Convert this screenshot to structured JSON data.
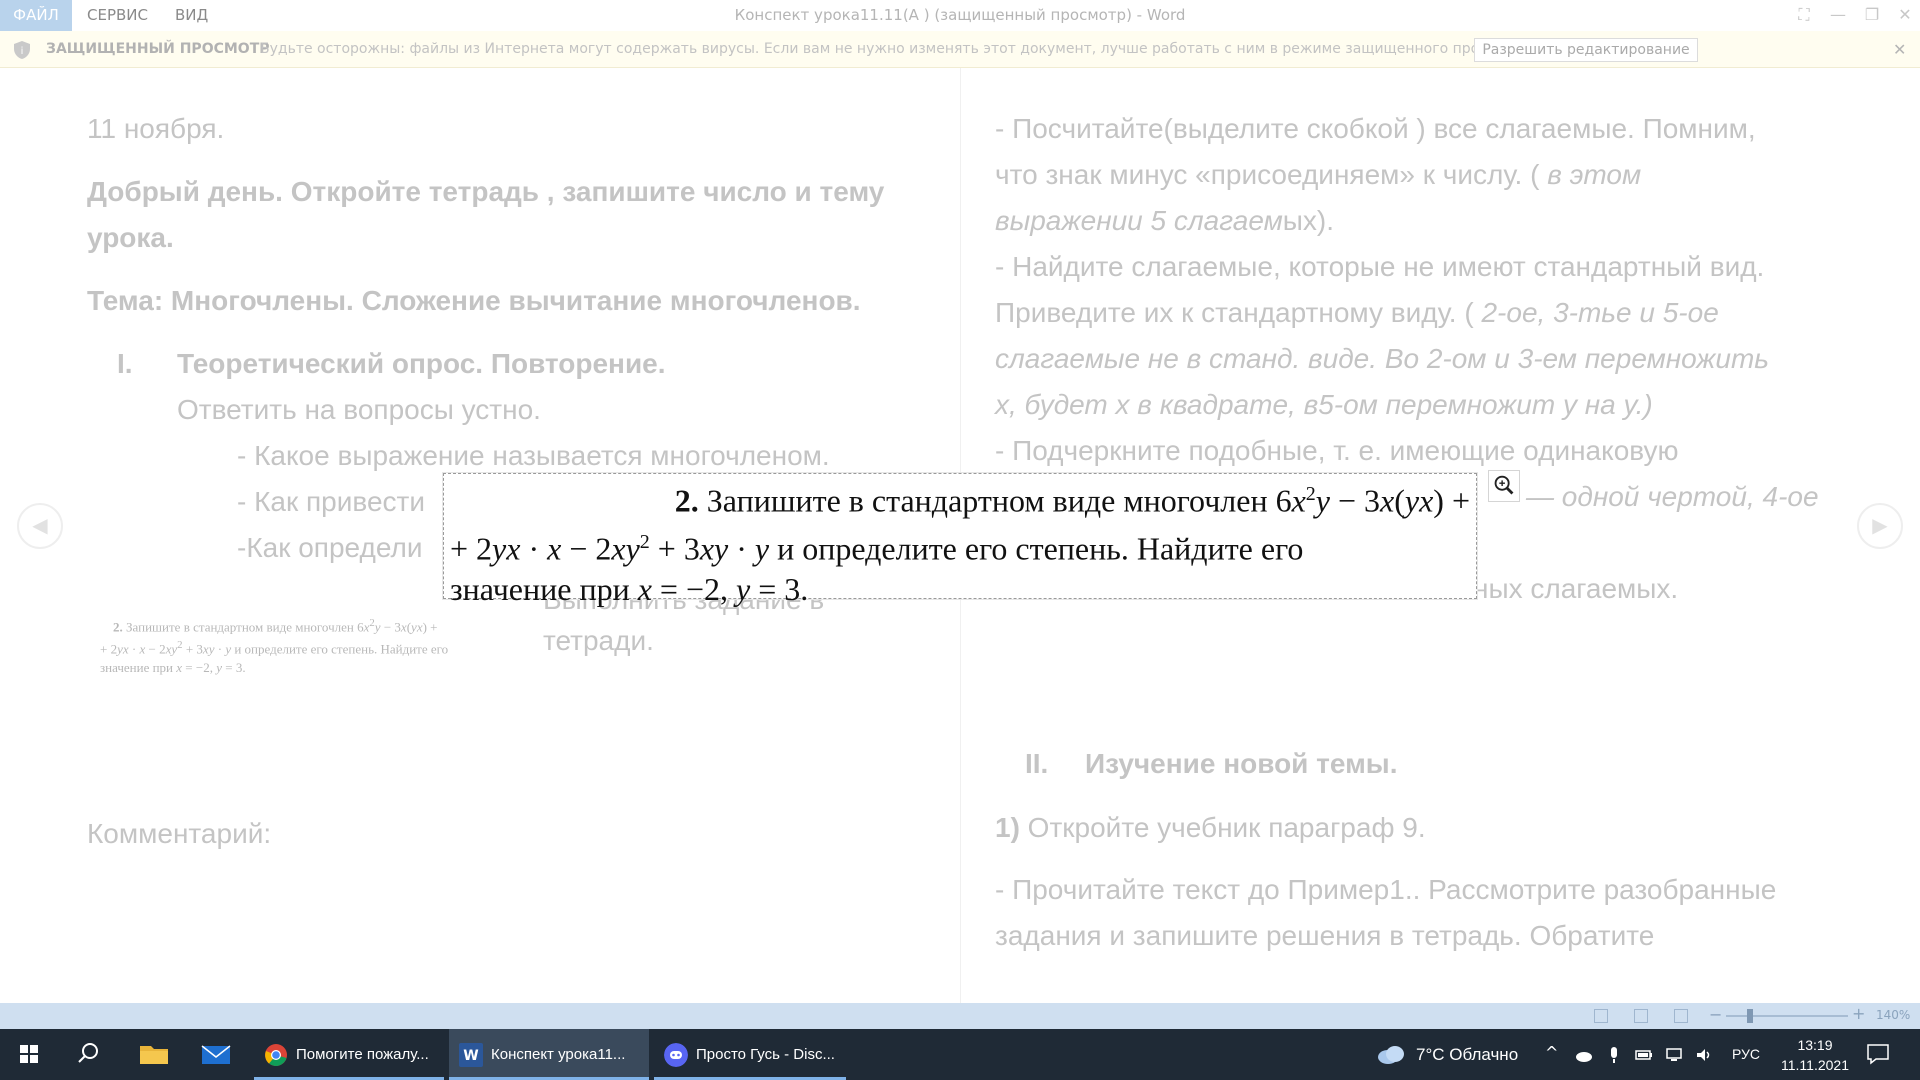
{
  "titlebar": {
    "tabs": [
      "ФАЙЛ",
      "СЕРВИС",
      "ВИД"
    ],
    "title": "Конспект урока11.11(А ) (защищенный просмотр) - Word"
  },
  "protected_view": {
    "label": "ЗАЩИЩЕННЫЙ ПРОСМОТР",
    "message": "Будьте осторожны: файлы из Интернета могут содержать вирусы. Если вам не нужно изменять этот документ, лучше работать с ним в режиме защищенного просмотра.",
    "button": "Разрешить редактирование"
  },
  "document": {
    "left": {
      "date": "11 ноября.",
      "greeting_1": "Добрый день. Откройте тетрадь , запишите число и тему",
      "greeting_2": "урока.",
      "topic": "Тема:  Многочлены. Сложение вычитание многочленов.",
      "section1_num": "I.",
      "section1_title": "Теоретический опрос. Повторение.",
      "oral": "Ответить на вопросы устно.",
      "q1": "- Какое выражение называется многочленом.",
      "q2": "- Как привести",
      "q3": "-Как определи",
      "task_1": "Выполнить задание в",
      "task_2": "тетради.",
      "comment": "Комментарий:"
    },
    "right": {
      "p1_l1": "- Посчитайте(выделите скобкой ) все слагаемые. Помним,",
      "p1_l2a": "что знак минус «присоединяем» к числу.  (",
      "p1_l2b": " в этом",
      "p1_l3a": "выражении 5 слагаем",
      "p1_l3b": "ых).",
      "p2_l1": "- Найдите слагаемые, которые не имеют стандартный вид.",
      "p2_l2a": "Приведите их к стандартному виду.  (",
      "p2_l2b": " 2-ое, 3-тье и 5-ое",
      "p2_l3": "слагаемые не в станд. виде.  Во 2-ом и 3-ем перемножить",
      "p2_l4": "х, будет х в квадрате, в5-ом перемножит у на у.)",
      "p3_l1": "- Подчеркните подобные, т. е.  имеющие одинаковую",
      "p3_l2": "— одной чертой, 4-ое",
      "p3_l4": "ных слагаемых.",
      "section2_num": "II.",
      "section2_title": "Изучение новой темы.",
      "s2_num": "1)",
      "s2_text": " Откройте учебник параграф 9.",
      "s2_p_l1": "- Прочитайте текст до Пример1.. Рассмотрите разобранные",
      "s2_p_l2": "задания  и запишите решения в тетрадь.  Обратите"
    },
    "image_task": {
      "num": "2.",
      "l1_a": " Запишите в стандартном виде многочлен 6",
      "l1_x": "x",
      "l1_sup": "2",
      "l1_b": "y",
      "l1_c": " − 3",
      "l1_d": "x",
      "l1_e": "(",
      "l1_f": "yx",
      "l1_g": ") +",
      "l2_a": "+ 2",
      "l2_b": "yx",
      "l2_c": " · ",
      "l2_d": "x",
      "l2_e": " − 2",
      "l2_f": "xy",
      "l2_sup": "2",
      "l2_g": " + 3",
      "l2_h": "xy",
      "l2_i": " · ",
      "l2_j": "y",
      "l2_k": " и определите его степень. Найдите его",
      "l3_a": "значение при ",
      "l3_b": "x",
      "l3_c": " = −2, ",
      "l3_d": "y",
      "l3_e": " = 3."
    }
  },
  "statusbar": {
    "zoom": "140%",
    "zoom_fraction": 0.2
  },
  "taskbar": {
    "apps": [
      {
        "label": "Помогите пожалу..."
      },
      {
        "label": "Конспект урока11..."
      },
      {
        "label": "Просто Гусь - Disc..."
      }
    ],
    "weather": "7°C  Облачно",
    "language": "РУС",
    "time": "13:19",
    "date": "11.11.2021"
  },
  "colors": {
    "accent": "#2b579a",
    "taskbar": "#1f2a36",
    "statusbar": "#cfdff0"
  }
}
